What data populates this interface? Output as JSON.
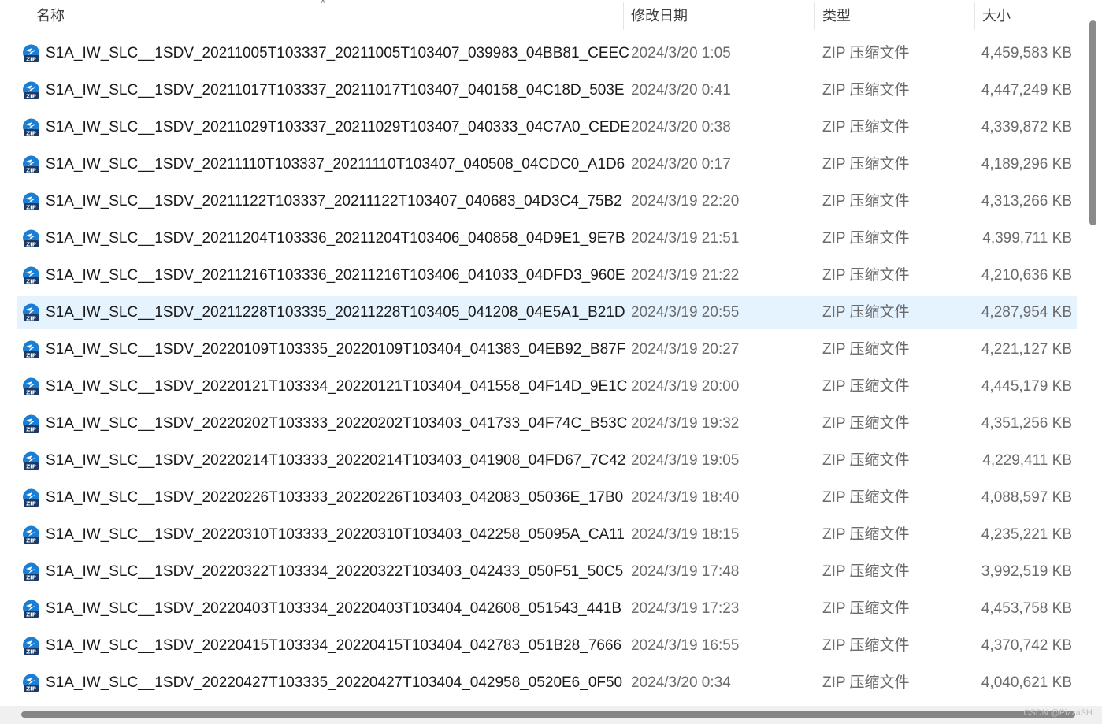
{
  "columns": {
    "name": "名称",
    "date": "修改日期",
    "type": "类型",
    "size": "大小"
  },
  "sort_indicator": "^",
  "icon": "zip-file-icon",
  "files": [
    {
      "name": "S1A_IW_SLC__1SDV_20211005T103337_20211005T103407_039983_04BB81_CEEC",
      "date": "2024/3/20 1:05",
      "type": "ZIP 压缩文件",
      "size": "4,459,583 KB"
    },
    {
      "name": "S1A_IW_SLC__1SDV_20211017T103337_20211017T103407_040158_04C18D_503E",
      "date": "2024/3/20 0:41",
      "type": "ZIP 压缩文件",
      "size": "4,447,249 KB"
    },
    {
      "name": "S1A_IW_SLC__1SDV_20211029T103337_20211029T103407_040333_04C7A0_CEDE",
      "date": "2024/3/20 0:38",
      "type": "ZIP 压缩文件",
      "size": "4,339,872 KB"
    },
    {
      "name": "S1A_IW_SLC__1SDV_20211110T103337_20211110T103407_040508_04CDC0_A1D6",
      "date": "2024/3/20 0:17",
      "type": "ZIP 压缩文件",
      "size": "4,189,296 KB"
    },
    {
      "name": "S1A_IW_SLC__1SDV_20211122T103337_20211122T103407_040683_04D3C4_75B2",
      "date": "2024/3/19 22:20",
      "type": "ZIP 压缩文件",
      "size": "4,313,266 KB"
    },
    {
      "name": "S1A_IW_SLC__1SDV_20211204T103336_20211204T103406_040858_04D9E1_9E7B",
      "date": "2024/3/19 21:51",
      "type": "ZIP 压缩文件",
      "size": "4,399,711 KB"
    },
    {
      "name": "S1A_IW_SLC__1SDV_20211216T103336_20211216T103406_041033_04DFD3_960E",
      "date": "2024/3/19 21:22",
      "type": "ZIP 压缩文件",
      "size": "4,210,636 KB"
    },
    {
      "name": "S1A_IW_SLC__1SDV_20211228T103335_20211228T103405_041208_04E5A1_B21D",
      "date": "2024/3/19 20:55",
      "type": "ZIP 压缩文件",
      "size": "4,287,954 KB",
      "selected": true
    },
    {
      "name": "S1A_IW_SLC__1SDV_20220109T103335_20220109T103404_041383_04EB92_B87F",
      "date": "2024/3/19 20:27",
      "type": "ZIP 压缩文件",
      "size": "4,221,127 KB"
    },
    {
      "name": "S1A_IW_SLC__1SDV_20220121T103334_20220121T103404_041558_04F14D_9E1C",
      "date": "2024/3/19 20:00",
      "type": "ZIP 压缩文件",
      "size": "4,445,179 KB"
    },
    {
      "name": "S1A_IW_SLC__1SDV_20220202T103333_20220202T103403_041733_04F74C_B53C",
      "date": "2024/3/19 19:32",
      "type": "ZIP 压缩文件",
      "size": "4,351,256 KB"
    },
    {
      "name": "S1A_IW_SLC__1SDV_20220214T103333_20220214T103403_041908_04FD67_7C42",
      "date": "2024/3/19 19:05",
      "type": "ZIP 压缩文件",
      "size": "4,229,411 KB"
    },
    {
      "name": "S1A_IW_SLC__1SDV_20220226T103333_20220226T103403_042083_05036E_17B0",
      "date": "2024/3/19 18:40",
      "type": "ZIP 压缩文件",
      "size": "4,088,597 KB"
    },
    {
      "name": "S1A_IW_SLC__1SDV_20220310T103333_20220310T103403_042258_05095A_CA11",
      "date": "2024/3/19 18:15",
      "type": "ZIP 压缩文件",
      "size": "4,235,221 KB"
    },
    {
      "name": "S1A_IW_SLC__1SDV_20220322T103334_20220322T103403_042433_050F51_50C5",
      "date": "2024/3/19 17:48",
      "type": "ZIP 压缩文件",
      "size": "3,992,519 KB"
    },
    {
      "name": "S1A_IW_SLC__1SDV_20220403T103334_20220403T103404_042608_051543_441B",
      "date": "2024/3/19 17:23",
      "type": "ZIP 压缩文件",
      "size": "4,453,758 KB"
    },
    {
      "name": "S1A_IW_SLC__1SDV_20220415T103334_20220415T103404_042783_051B28_7666",
      "date": "2024/3/19 16:55",
      "type": "ZIP 压缩文件",
      "size": "4,370,742 KB"
    },
    {
      "name": "S1A_IW_SLC__1SDV_20220427T103335_20220427T103404_042958_0520E6_0F50",
      "date": "2024/3/20 0:34",
      "type": "ZIP 压缩文件",
      "size": "4,040,621 KB"
    }
  ],
  "watermark": "CSDN @PizzaSH"
}
